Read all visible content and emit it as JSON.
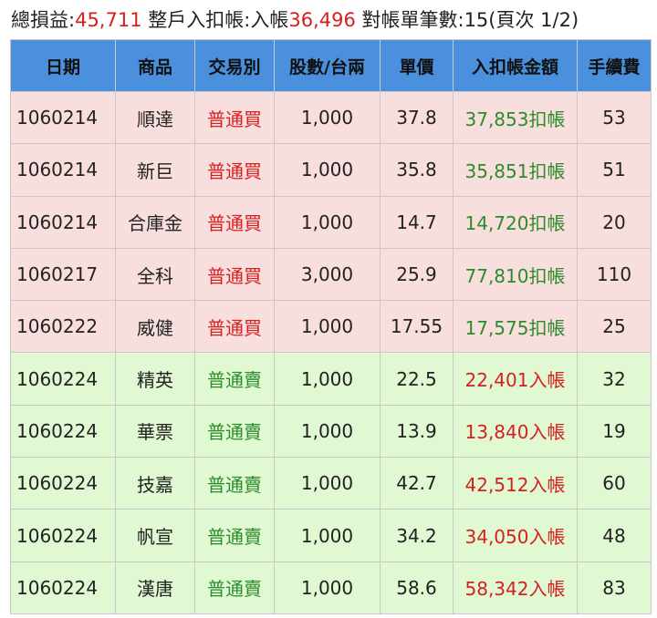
{
  "summary": {
    "total_label": "總損益:",
    "total_value": "45,711",
    "credit_label": "整戶入扣帳:入帳",
    "credit_value": "36,496",
    "count_text": "對帳單筆數:15(頁次 1/2)"
  },
  "colors": {
    "header_bg": "#4a90dd",
    "buy_row_bg": "#f9dede",
    "sell_row_bg": "#e1f9d3",
    "red": "#d62020",
    "green": "#2a8c2a"
  },
  "table": {
    "headers": [
      "日期",
      "商品",
      "交易別",
      "股數/台兩",
      "單價",
      "入扣帳金額",
      "手續費"
    ],
    "rows": [
      {
        "date": "1060214",
        "product": "順達",
        "type": "普通買",
        "shares": "1,000",
        "price": "37.8",
        "amount": "37,853扣帳",
        "fee": "53",
        "side": "buy"
      },
      {
        "date": "1060214",
        "product": "新巨",
        "type": "普通買",
        "shares": "1,000",
        "price": "35.8",
        "amount": "35,851扣帳",
        "fee": "51",
        "side": "buy"
      },
      {
        "date": "1060214",
        "product": "合庫金",
        "type": "普通買",
        "shares": "1,000",
        "price": "14.7",
        "amount": "14,720扣帳",
        "fee": "20",
        "side": "buy"
      },
      {
        "date": "1060217",
        "product": "全科",
        "type": "普通買",
        "shares": "3,000",
        "price": "25.9",
        "amount": "77,810扣帳",
        "fee": "110",
        "side": "buy"
      },
      {
        "date": "1060222",
        "product": "威健",
        "type": "普通買",
        "shares": "1,000",
        "price": "17.55",
        "amount": "17,575扣帳",
        "fee": "25",
        "side": "buy"
      },
      {
        "date": "1060224",
        "product": "精英",
        "type": "普通賣",
        "shares": "1,000",
        "price": "22.5",
        "amount": "22,401入帳",
        "fee": "32",
        "side": "sell"
      },
      {
        "date": "1060224",
        "product": "華票",
        "type": "普通賣",
        "shares": "1,000",
        "price": "13.9",
        "amount": "13,840入帳",
        "fee": "19",
        "side": "sell"
      },
      {
        "date": "1060224",
        "product": "技嘉",
        "type": "普通賣",
        "shares": "1,000",
        "price": "42.7",
        "amount": "42,512入帳",
        "fee": "60",
        "side": "sell"
      },
      {
        "date": "1060224",
        "product": "帆宣",
        "type": "普通賣",
        "shares": "1,000",
        "price": "34.2",
        "amount": "34,050入帳",
        "fee": "48",
        "side": "sell"
      },
      {
        "date": "1060224",
        "product": "漢唐",
        "type": "普通賣",
        "shares": "1,000",
        "price": "58.6",
        "amount": "58,342入帳",
        "fee": "83",
        "side": "sell"
      }
    ]
  }
}
